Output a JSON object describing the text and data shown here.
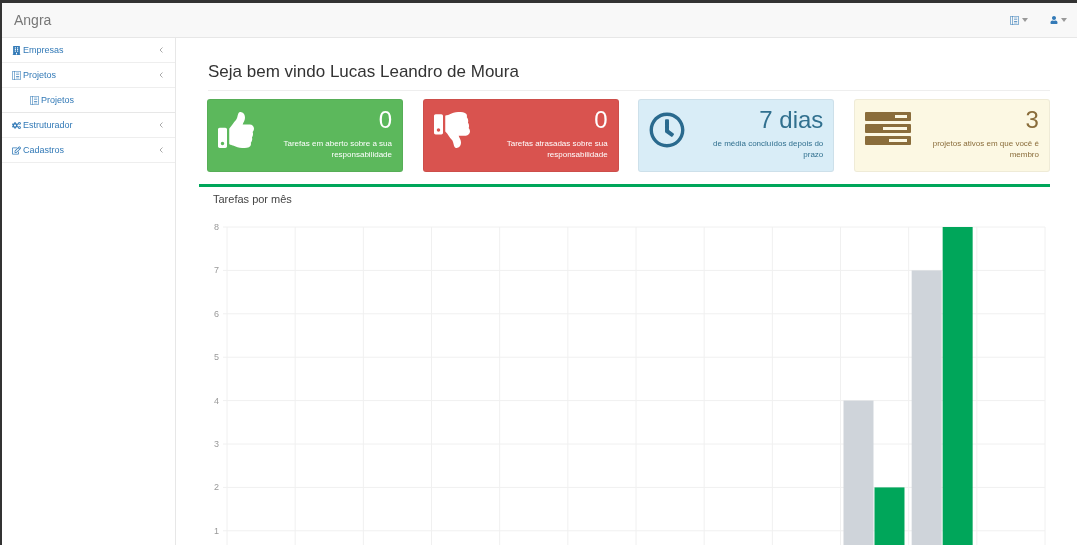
{
  "navbar": {
    "brand": "Angra"
  },
  "sidebar": {
    "items": [
      {
        "label": "Empresas",
        "kind": "building"
      },
      {
        "label": "Projetos",
        "kind": "board",
        "children": [
          {
            "label": "Projetos",
            "kind": "board"
          }
        ]
      },
      {
        "label": "Estruturador",
        "kind": "gears"
      },
      {
        "label": "Cadastros",
        "kind": "edit"
      }
    ]
  },
  "heading": "Seja bem vindo Lucas Leandro de Moura",
  "cards": [
    {
      "kind": "success",
      "value": "0",
      "text": "Tarefas em aberto sobre a sua responsabilidade"
    },
    {
      "kind": "danger",
      "value": "0",
      "text": "Tarefas atrasadas sobre sua responsabilidade"
    },
    {
      "kind": "info",
      "value": "7 dias",
      "text": "de média concluídos depois do prazo"
    },
    {
      "kind": "warning",
      "value": "3",
      "text": "projetos ativos em que você é membro"
    }
  ],
  "chart": {
    "title": "Tarefas por mês",
    "chart_data": {
      "type": "bar",
      "grid": true,
      "ylim": [
        0,
        8
      ],
      "yticks": [
        1,
        2,
        3,
        4,
        5,
        6,
        7,
        8
      ],
      "series": [
        {
          "color": "#cfd4da",
          "values": [
            0,
            0,
            0,
            0,
            0,
            0,
            0,
            0,
            0,
            4,
            7,
            0
          ]
        },
        {
          "color": "#00a65a",
          "values": [
            0,
            0,
            0,
            0,
            0,
            0,
            0,
            0,
            0,
            2,
            8,
            0
          ]
        }
      ]
    }
  }
}
